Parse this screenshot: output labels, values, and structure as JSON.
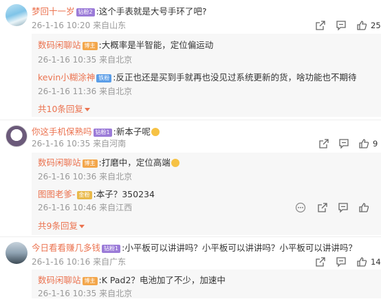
{
  "comments": [
    {
      "user": "梦回十一岁",
      "badge": "钻粉2",
      "text": ":这个手表就是大号手环了吧?",
      "time": "26-1-16 10:20",
      "location": "来自山东",
      "likes": "25",
      "replies": [
        {
          "user": "数码闲聊站",
          "badge": "博主",
          "text": ":大概率是半智能，定位偏运动",
          "time": "26-1-16 10:35",
          "location": "来自北京"
        },
        {
          "user": "kevin小糊涂神",
          "badge": "铁粉",
          "text": ":反正也还是买到手就再也没见过系统更新的货，啥功能也不期待",
          "time": "26-1-16 11:36",
          "location": "来自北京"
        }
      ],
      "more": "共10条回复"
    },
    {
      "user": "你这手机保熟吗",
      "badge": "钻粉1",
      "text": ":新本子呢",
      "time": "26-1-16 10:35",
      "location": "来自河南",
      "likes": "9",
      "replies": [
        {
          "user": "数码闲聊站",
          "badge": "博主",
          "text": ":打磨中，定位高端",
          "time": "26-1-16 10:36",
          "location": "来自北京"
        },
        {
          "user": "图图老爹-",
          "badge": "金粉",
          "text": ":本子？350234",
          "time": "26-1-16 10:46",
          "location": "来自江西"
        }
      ],
      "more": "共9条回复"
    },
    {
      "user": "今日看看赚几多钱",
      "badge": "钻粉1",
      "text": ":小平板可以讲讲吗？小平板可以讲讲吗？小平板可以讲讲吗？",
      "time": "26-1-16 10:16",
      "location": "来自广东",
      "likes": "14",
      "replies": [
        {
          "user": "数码闲聊站",
          "badge": "博主",
          "text": ":K Pad2？电池加了不少，加速中",
          "time": "26-1-16 10:35",
          "location": "来自北京"
        }
      ]
    }
  ],
  "icons": {
    "share": "share-icon",
    "comment": "comment-icon",
    "like": "thumbs-up-icon",
    "more": "more-dots-icon"
  },
  "colors": {
    "username": "#eb7350",
    "meta": "#999999",
    "reply_bg": "#f7f7f7"
  }
}
